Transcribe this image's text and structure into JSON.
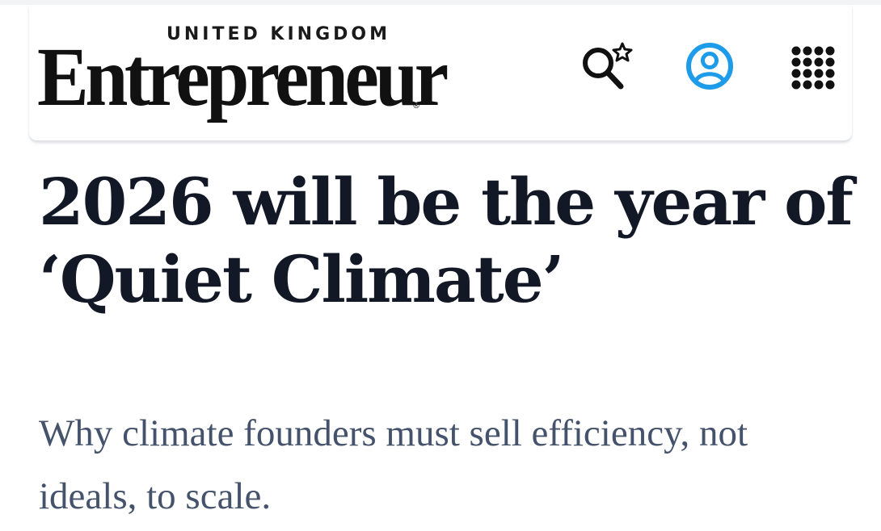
{
  "header": {
    "logo_region": "UNITED KINGDOM",
    "logo_wordmark": "Entrepreneur",
    "logo_trademark": "®",
    "icons": {
      "search": "search-star-icon",
      "account": "user-circle-icon",
      "apps": "apps-grid-icon"
    }
  },
  "article": {
    "headline": "2026 will be the year of ‘Quiet Climate’",
    "subheadline": "Why climate founders must sell efficiency, not ideals, to scale."
  },
  "colors": {
    "account_icon": "#1e9be9",
    "icon_dark": "#111111",
    "headline": "#121826",
    "subheadline": "#44536b"
  }
}
